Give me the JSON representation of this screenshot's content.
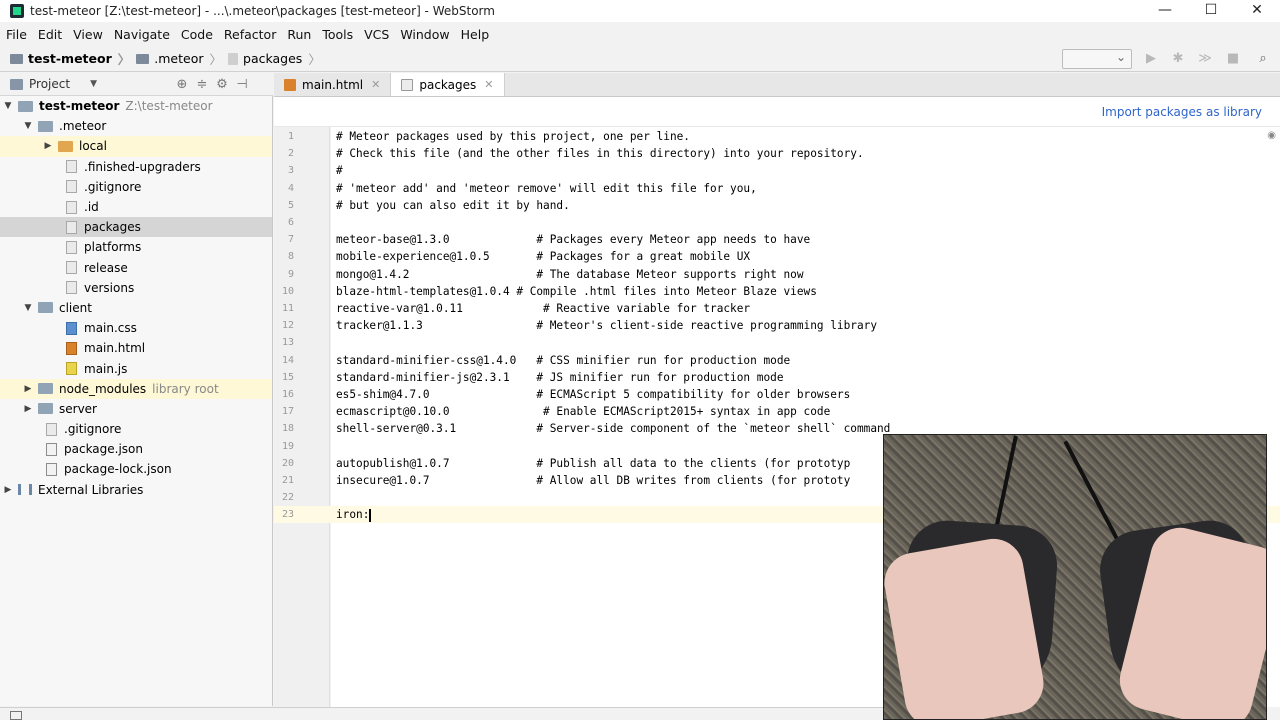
{
  "window": {
    "title": "test-meteor [Z:\\test-meteor] - ...\\.meteor\\packages [test-meteor] - WebStorm",
    "minimize": "—",
    "maximize": "☐",
    "close": "✕"
  },
  "menu": [
    "File",
    "Edit",
    "View",
    "Navigate",
    "Code",
    "Refactor",
    "Run",
    "Tools",
    "VCS",
    "Window",
    "Help"
  ],
  "breadcrumb": [
    "test-meteor",
    ".meteor",
    "packages"
  ],
  "project_panel": {
    "title": "Project",
    "tree": [
      {
        "label": "test-meteor",
        "path": "Z:\\test-meteor"
      },
      {
        "label": ".meteor"
      },
      {
        "label": "local"
      },
      {
        "label": ".finished-upgraders"
      },
      {
        "label": ".gitignore"
      },
      {
        "label": ".id"
      },
      {
        "label": "packages"
      },
      {
        "label": "platforms"
      },
      {
        "label": "release"
      },
      {
        "label": "versions"
      },
      {
        "label": "client"
      },
      {
        "label": "main.css"
      },
      {
        "label": "main.html"
      },
      {
        "label": "main.js"
      },
      {
        "label": "node_modules",
        "path": "library root"
      },
      {
        "label": "server"
      },
      {
        "label": ".gitignore"
      },
      {
        "label": "package.json"
      },
      {
        "label": "package-lock.json"
      },
      {
        "label": "External Libraries"
      }
    ]
  },
  "tabs": [
    "main.html",
    "packages"
  ],
  "notice": {
    "link": "Import packages as library"
  },
  "editor": {
    "lines": [
      "# Meteor packages used by this project, one per line.",
      "# Check this file (and the other files in this directory) into your repository.",
      "#",
      "# 'meteor add' and 'meteor remove' will edit this file for you,",
      "# but you can also edit it by hand.",
      "",
      "meteor-base@1.3.0             # Packages every Meteor app needs to have",
      "mobile-experience@1.0.5       # Packages for a great mobile UX",
      "mongo@1.4.2                   # The database Meteor supports right now",
      "blaze-html-templates@1.0.4 # Compile .html files into Meteor Blaze views",
      "reactive-var@1.0.11            # Reactive variable for tracker",
      "tracker@1.1.3                 # Meteor's client-side reactive programming library",
      "",
      "standard-minifier-css@1.4.0   # CSS minifier run for production mode",
      "standard-minifier-js@2.3.1    # JS minifier run for production mode",
      "es5-shim@4.7.0                # ECMAScript 5 compatibility for older browsers",
      "ecmascript@0.10.0              # Enable ECMAScript2015+ syntax in app code",
      "shell-server@0.3.1            # Server-side component of the `meteor shell` command",
      "",
      "autopublish@1.0.7             # Publish all data to the clients (for prototyp",
      "insecure@1.0.7                # Allow all DB writes from clients (for prototy",
      "",
      "iron:"
    ],
    "line_numbers": [
      "1",
      "2",
      "3",
      "4",
      "5",
      "6",
      "7",
      "8",
      "9",
      "10",
      "11",
      "12",
      "13",
      "14",
      "15",
      "16",
      "17",
      "18",
      "19",
      "20",
      "21",
      "22",
      "23"
    ]
  }
}
